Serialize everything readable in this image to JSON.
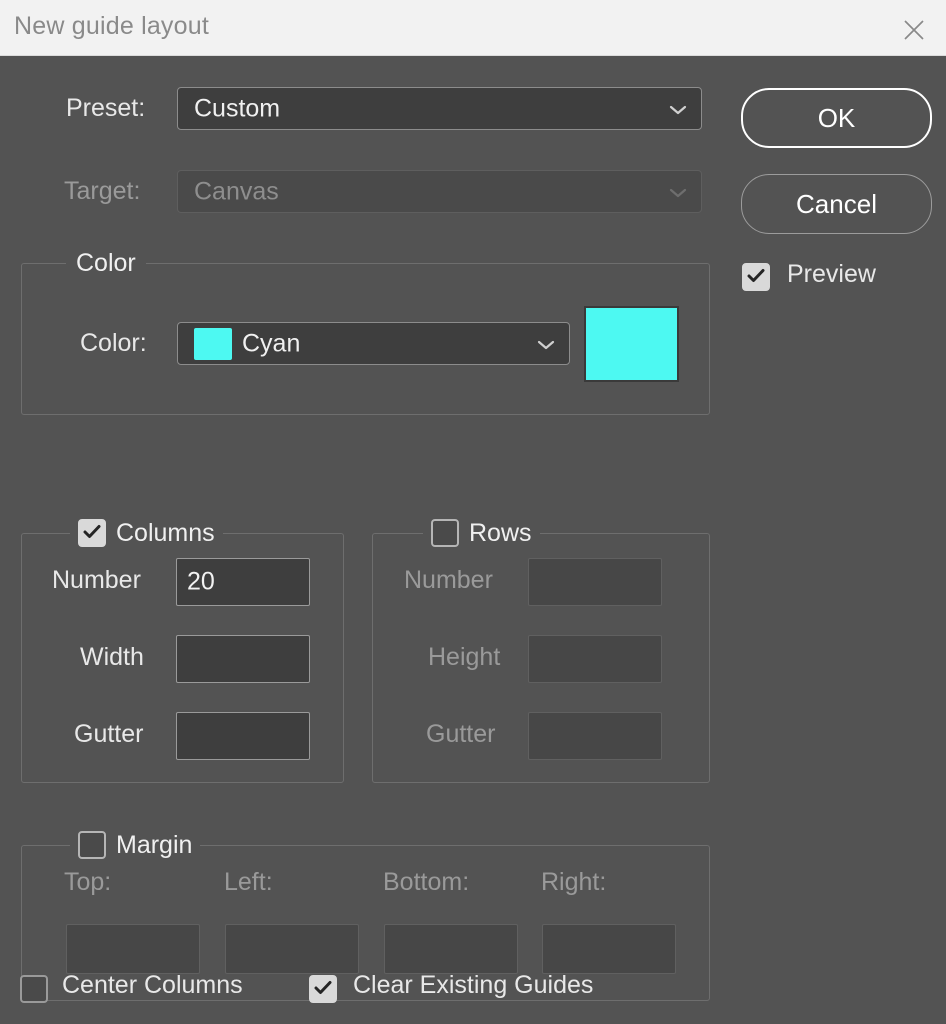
{
  "window": {
    "title": "New guide layout",
    "close_icon": "close-icon"
  },
  "preset": {
    "label": "Preset:",
    "value": "Custom",
    "chevron_icon": "chevron-down-icon"
  },
  "target": {
    "label": "Target:",
    "value": "Canvas",
    "chevron_icon": "chevron-down-icon",
    "disabled": true
  },
  "buttons": {
    "ok": "OK",
    "cancel": "Cancel"
  },
  "preview": {
    "label": "Preview",
    "checked": true
  },
  "color_group": {
    "legend": "Color",
    "field_label": "Color:",
    "value": "Cyan",
    "swatch_hex": "#4DF9F2",
    "chevron_icon": "chevron-down-icon"
  },
  "columns_group": {
    "legend": "Columns",
    "checked": true,
    "rows": [
      {
        "label": "Number",
        "value": "20"
      },
      {
        "label": "Width",
        "value": ""
      },
      {
        "label": "Gutter",
        "value": ""
      }
    ]
  },
  "rows_group": {
    "legend": "Rows",
    "checked": false,
    "rows": [
      {
        "label": "Number",
        "value": ""
      },
      {
        "label": "Height",
        "value": ""
      },
      {
        "label": "Gutter",
        "value": ""
      }
    ]
  },
  "margin_group": {
    "legend": "Margin",
    "checked": false,
    "fields": [
      {
        "label": "Top:",
        "value": ""
      },
      {
        "label": "Left:",
        "value": ""
      },
      {
        "label": "Bottom:",
        "value": ""
      },
      {
        "label": "Right:",
        "value": ""
      }
    ]
  },
  "footer": {
    "center_columns": {
      "label": "Center Columns",
      "checked": false
    },
    "clear_existing_guides": {
      "label": "Clear Existing Guides",
      "checked": true
    }
  },
  "theme": {
    "dialog_bg": "#535353",
    "titlebar_bg": "#F2F2F2",
    "accent_cyan": "#4DF9F2",
    "field_bg": "#3E3E3E",
    "text": "#E8E8E8",
    "text_disabled": "#9A9A9A"
  }
}
